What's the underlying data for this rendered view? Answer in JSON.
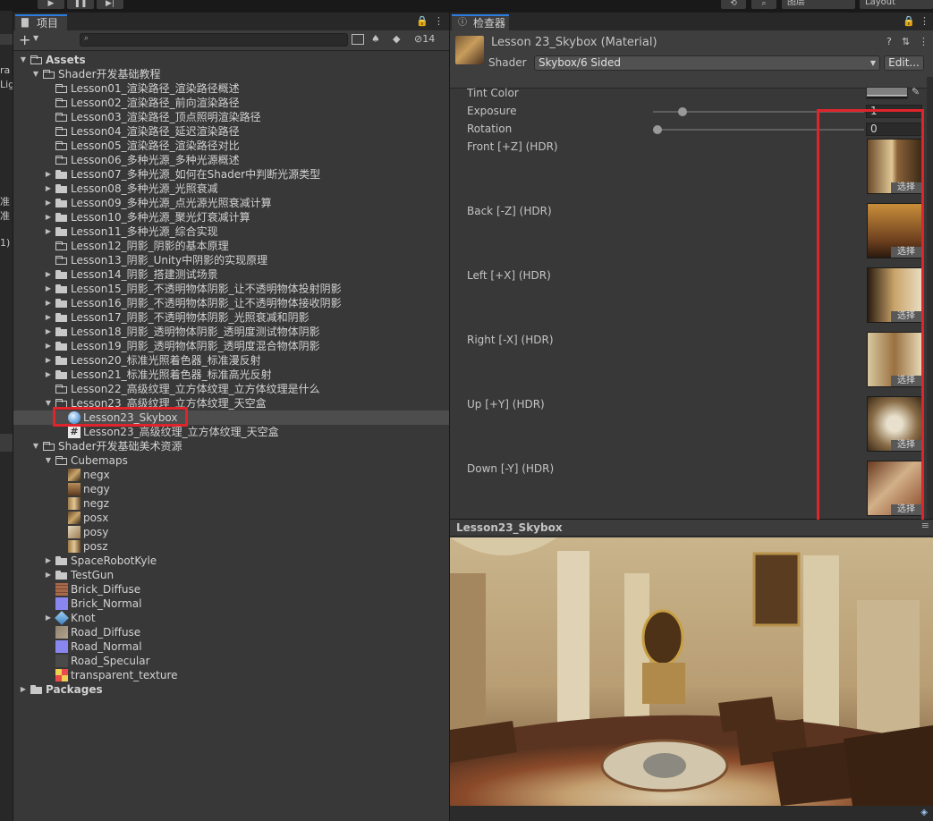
{
  "project_panel": {
    "tab_label": "项目",
    "hidden_count": "14",
    "tree": [
      {
        "depth": 0,
        "label": "Assets",
        "icon": "folder-open",
        "arrow": "down",
        "bold": true
      },
      {
        "depth": 1,
        "label": "Shader开发基础教程",
        "icon": "folder-open",
        "arrow": "down"
      },
      {
        "depth": 2,
        "label": "Lesson01_渲染路径_渲染路径概述",
        "icon": "folder-outline"
      },
      {
        "depth": 2,
        "label": "Lesson02_渲染路径_前向渲染路径",
        "icon": "folder-outline"
      },
      {
        "depth": 2,
        "label": "Lesson03_渲染路径_顶点照明渲染路径",
        "icon": "folder-outline"
      },
      {
        "depth": 2,
        "label": "Lesson04_渲染路径_延迟渲染路径",
        "icon": "folder-outline"
      },
      {
        "depth": 2,
        "label": "Lesson05_渲染路径_渲染路径对比",
        "icon": "folder-outline"
      },
      {
        "depth": 2,
        "label": "Lesson06_多种光源_多种光源概述",
        "icon": "folder-outline"
      },
      {
        "depth": 2,
        "label": "Lesson07_多种光源_如何在Shader中判断光源类型",
        "icon": "folder-closed",
        "arrow": "right"
      },
      {
        "depth": 2,
        "label": "Lesson08_多种光源_光照衰减",
        "icon": "folder-closed",
        "arrow": "right"
      },
      {
        "depth": 2,
        "label": "Lesson09_多种光源_点光源光照衰减计算",
        "icon": "folder-closed",
        "arrow": "right"
      },
      {
        "depth": 2,
        "label": "Lesson10_多种光源_聚光灯衰减计算",
        "icon": "folder-closed",
        "arrow": "right"
      },
      {
        "depth": 2,
        "label": "Lesson11_多种光源_综合实现",
        "icon": "folder-closed",
        "arrow": "right"
      },
      {
        "depth": 2,
        "label": "Lesson12_阴影_阴影的基本原理",
        "icon": "folder-outline"
      },
      {
        "depth": 2,
        "label": "Lesson13_阴影_Unity中阴影的实现原理",
        "icon": "folder-outline"
      },
      {
        "depth": 2,
        "label": "Lesson14_阴影_搭建测试场景",
        "icon": "folder-closed",
        "arrow": "right"
      },
      {
        "depth": 2,
        "label": "Lesson15_阴影_不透明物体阴影_让不透明物体投射阴影",
        "icon": "folder-closed",
        "arrow": "right"
      },
      {
        "depth": 2,
        "label": "Lesson16_阴影_不透明物体阴影_让不透明物体接收阴影",
        "icon": "folder-closed",
        "arrow": "right"
      },
      {
        "depth": 2,
        "label": "Lesson17_阴影_不透明物体阴影_光照衰减和阴影",
        "icon": "folder-closed",
        "arrow": "right"
      },
      {
        "depth": 2,
        "label": "Lesson18_阴影_透明物体阴影_透明度测试物体阴影",
        "icon": "folder-closed",
        "arrow": "right"
      },
      {
        "depth": 2,
        "label": "Lesson19_阴影_透明物体阴影_透明度混合物体阴影",
        "icon": "folder-closed",
        "arrow": "right"
      },
      {
        "depth": 2,
        "label": "Lesson20_标准光照着色器_标准漫反射",
        "icon": "folder-closed",
        "arrow": "right"
      },
      {
        "depth": 2,
        "label": "Lesson21_标准光照着色器_标准高光反射",
        "icon": "folder-closed",
        "arrow": "right"
      },
      {
        "depth": 2,
        "label": "Lesson22_高级纹理_立方体纹理_立方体纹理是什么",
        "icon": "folder-outline"
      },
      {
        "depth": 2,
        "label": "Lesson23_高级纹理_立方体纹理_天空盒",
        "icon": "folder-open",
        "arrow": "down"
      },
      {
        "depth": 3,
        "label": "Lesson23_Skybox",
        "icon": "material",
        "selected": true
      },
      {
        "depth": 3,
        "label": "Lesson23_高级纹理_立方体纹理_天空盒",
        "icon": "script"
      },
      {
        "depth": 1,
        "label": "Shader开发基础美术资源",
        "icon": "folder-open",
        "arrow": "down"
      },
      {
        "depth": 2,
        "label": "Cubemaps",
        "icon": "folder-open",
        "arrow": "down"
      },
      {
        "depth": 3,
        "label": "negx",
        "icon": "tex-a"
      },
      {
        "depth": 3,
        "label": "negy",
        "icon": "tex-b"
      },
      {
        "depth": 3,
        "label": "negz",
        "icon": "tex-c"
      },
      {
        "depth": 3,
        "label": "posx",
        "icon": "tex-a"
      },
      {
        "depth": 3,
        "label": "posy",
        "icon": "tex-d"
      },
      {
        "depth": 3,
        "label": "posz",
        "icon": "tex-c"
      },
      {
        "depth": 2,
        "label": "SpaceRobotKyle",
        "icon": "folder-closed",
        "arrow": "right"
      },
      {
        "depth": 2,
        "label": "TestGun",
        "icon": "folder-closed",
        "arrow": "right"
      },
      {
        "depth": 2,
        "label": "Brick_Diffuse",
        "icon": "tex-brick"
      },
      {
        "depth": 2,
        "label": "Brick_Normal",
        "icon": "tex-normal"
      },
      {
        "depth": 2,
        "label": "Knot",
        "icon": "model",
        "arrow": "right"
      },
      {
        "depth": 2,
        "label": "Road_Diffuse",
        "icon": "tex-road"
      },
      {
        "depth": 2,
        "label": "Road_Normal",
        "icon": "tex-normal"
      },
      {
        "depth": 2,
        "label": "Road_Specular",
        "icon": "tex-spec"
      },
      {
        "depth": 2,
        "label": "transparent_texture",
        "icon": "tex-trans"
      },
      {
        "depth": 0,
        "label": "Packages",
        "icon": "folder-closed",
        "arrow": "right",
        "bold": true
      }
    ]
  },
  "inspector": {
    "tab_label": "检查器",
    "material_title": "Lesson 23_Skybox (Material)",
    "shader_label": "Shader",
    "shader_value": "Skybox/6 Sided",
    "edit_button": "Edit...",
    "tint_label": "Tint Color",
    "exposure_label": "Exposure",
    "exposure_value": "1",
    "rotation_label": "Rotation",
    "rotation_value": "0",
    "pick_label": "选择",
    "faces": [
      {
        "label": "Front [+Z]   (HDR)"
      },
      {
        "label": "Back [-Z]   (HDR)"
      },
      {
        "label": "Left [+X]   (HDR)"
      },
      {
        "label": "Right [-X]   (HDR)"
      },
      {
        "label": "Up [+Y]   (HDR)"
      },
      {
        "label": "Down [-Y]   (HDR)"
      }
    ]
  },
  "preview": {
    "title": "Lesson23_Skybox"
  },
  "toolbar": {
    "layers_label": "图层",
    "layout_label": "Layout"
  },
  "left_strip_fragments": [
    "ra",
    "Lig",
    "准",
    "准",
    "1)"
  ],
  "colors": {
    "accent_tab": "#2d7ce0",
    "highlight_box": "#e0242c",
    "selected_row": "#4d4d4d"
  }
}
